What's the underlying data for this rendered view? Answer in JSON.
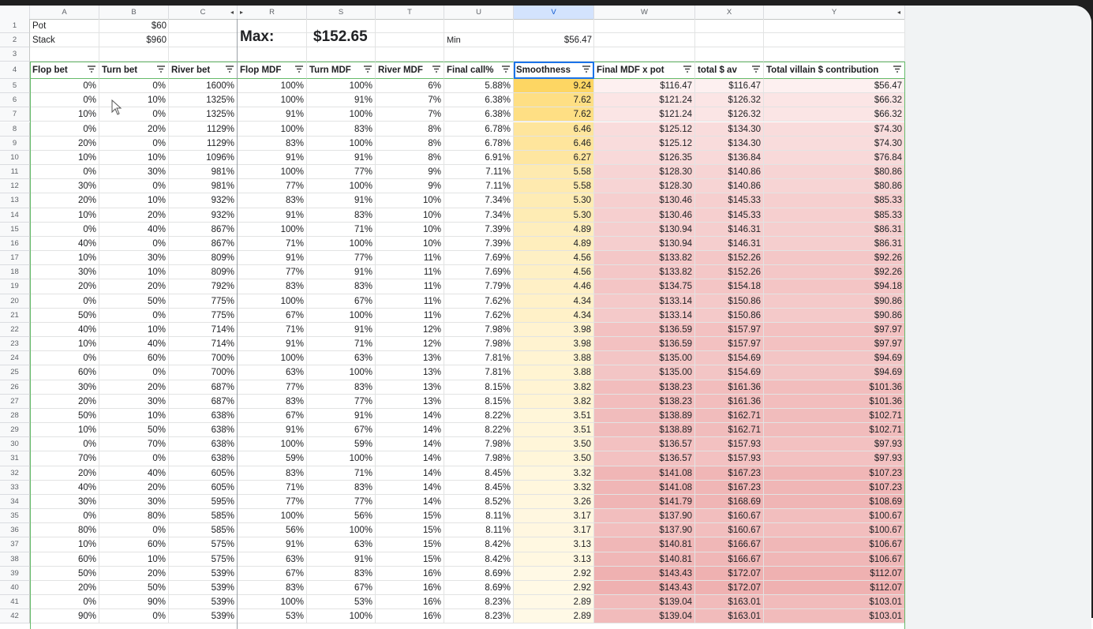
{
  "columns": [
    {
      "letter": "A",
      "header": "Flop bet"
    },
    {
      "letter": "B",
      "header": "Turn bet"
    },
    {
      "letter": "C",
      "header": "River bet"
    },
    {
      "letter": "R",
      "header": "Flop MDF"
    },
    {
      "letter": "S",
      "header": "Turn MDF"
    },
    {
      "letter": "T",
      "header": "River MDF"
    },
    {
      "letter": "U",
      "header": "Final call%"
    },
    {
      "letter": "V",
      "header": "Smoothness"
    },
    {
      "letter": "W",
      "header": "Final MDF x pot"
    },
    {
      "letter": "X",
      "header": "total $ av"
    },
    {
      "letter": "Y",
      "header": "Total villain $ contribution"
    }
  ],
  "top": {
    "pot_label": "Pot",
    "pot_value": "$60",
    "stack_label": "Stack",
    "stack_value": "$960",
    "max_label": "Max:",
    "max_value": "$152.65",
    "min_label": "Min",
    "min_value": "$56.47"
  },
  "header_row_number": "4",
  "top_row_numbers": [
    "1",
    "2",
    "3"
  ],
  "colors": {
    "smooth_max": "#fdd663",
    "smooth_min": "#fff9e6",
    "pink_max": "#efb1b1",
    "pink_min": "#fdf0f0",
    "selection": "#1a73e8",
    "filter_green": "#66bb6a"
  },
  "rows": [
    {
      "n": "5",
      "v": [
        "0%",
        "0%",
        "1600%",
        "100%",
        "100%",
        "6%",
        "5.88%",
        "9.24",
        "$116.47",
        "$116.47",
        "$56.47"
      ]
    },
    {
      "n": "6",
      "v": [
        "0%",
        "10%",
        "1325%",
        "100%",
        "91%",
        "7%",
        "6.38%",
        "7.62",
        "$121.24",
        "$126.32",
        "$66.32"
      ]
    },
    {
      "n": "7",
      "v": [
        "10%",
        "0%",
        "1325%",
        "91%",
        "100%",
        "7%",
        "6.38%",
        "7.62",
        "$121.24",
        "$126.32",
        "$66.32"
      ]
    },
    {
      "n": "8",
      "v": [
        "0%",
        "20%",
        "1129%",
        "100%",
        "83%",
        "8%",
        "6.78%",
        "6.46",
        "$125.12",
        "$134.30",
        "$74.30"
      ]
    },
    {
      "n": "9",
      "v": [
        "20%",
        "0%",
        "1129%",
        "83%",
        "100%",
        "8%",
        "6.78%",
        "6.46",
        "$125.12",
        "$134.30",
        "$74.30"
      ]
    },
    {
      "n": "10",
      "v": [
        "10%",
        "10%",
        "1096%",
        "91%",
        "91%",
        "8%",
        "6.91%",
        "6.27",
        "$126.35",
        "$136.84",
        "$76.84"
      ]
    },
    {
      "n": "11",
      "v": [
        "0%",
        "30%",
        "981%",
        "100%",
        "77%",
        "9%",
        "7.11%",
        "5.58",
        "$128.30",
        "$140.86",
        "$80.86"
      ]
    },
    {
      "n": "12",
      "v": [
        "30%",
        "0%",
        "981%",
        "77%",
        "100%",
        "9%",
        "7.11%",
        "5.58",
        "$128.30",
        "$140.86",
        "$80.86"
      ]
    },
    {
      "n": "13",
      "v": [
        "20%",
        "10%",
        "932%",
        "83%",
        "91%",
        "10%",
        "7.34%",
        "5.30",
        "$130.46",
        "$145.33",
        "$85.33"
      ]
    },
    {
      "n": "14",
      "v": [
        "10%",
        "20%",
        "932%",
        "91%",
        "83%",
        "10%",
        "7.34%",
        "5.30",
        "$130.46",
        "$145.33",
        "$85.33"
      ]
    },
    {
      "n": "15",
      "v": [
        "0%",
        "40%",
        "867%",
        "100%",
        "71%",
        "10%",
        "7.39%",
        "4.89",
        "$130.94",
        "$146.31",
        "$86.31"
      ]
    },
    {
      "n": "16",
      "v": [
        "40%",
        "0%",
        "867%",
        "71%",
        "100%",
        "10%",
        "7.39%",
        "4.89",
        "$130.94",
        "$146.31",
        "$86.31"
      ]
    },
    {
      "n": "17",
      "v": [
        "10%",
        "30%",
        "809%",
        "91%",
        "77%",
        "11%",
        "7.69%",
        "4.56",
        "$133.82",
        "$152.26",
        "$92.26"
      ]
    },
    {
      "n": "18",
      "v": [
        "30%",
        "10%",
        "809%",
        "77%",
        "91%",
        "11%",
        "7.69%",
        "4.56",
        "$133.82",
        "$152.26",
        "$92.26"
      ]
    },
    {
      "n": "19",
      "v": [
        "20%",
        "20%",
        "792%",
        "83%",
        "83%",
        "11%",
        "7.79%",
        "4.46",
        "$134.75",
        "$154.18",
        "$94.18"
      ]
    },
    {
      "n": "20",
      "v": [
        "0%",
        "50%",
        "775%",
        "100%",
        "67%",
        "11%",
        "7.62%",
        "4.34",
        "$133.14",
        "$150.86",
        "$90.86"
      ]
    },
    {
      "n": "21",
      "v": [
        "50%",
        "0%",
        "775%",
        "67%",
        "100%",
        "11%",
        "7.62%",
        "4.34",
        "$133.14",
        "$150.86",
        "$90.86"
      ]
    },
    {
      "n": "22",
      "v": [
        "40%",
        "10%",
        "714%",
        "71%",
        "91%",
        "12%",
        "7.98%",
        "3.98",
        "$136.59",
        "$157.97",
        "$97.97"
      ]
    },
    {
      "n": "23",
      "v": [
        "10%",
        "40%",
        "714%",
        "91%",
        "71%",
        "12%",
        "7.98%",
        "3.98",
        "$136.59",
        "$157.97",
        "$97.97"
      ]
    },
    {
      "n": "24",
      "v": [
        "0%",
        "60%",
        "700%",
        "100%",
        "63%",
        "13%",
        "7.81%",
        "3.88",
        "$135.00",
        "$154.69",
        "$94.69"
      ]
    },
    {
      "n": "25",
      "v": [
        "60%",
        "0%",
        "700%",
        "63%",
        "100%",
        "13%",
        "7.81%",
        "3.88",
        "$135.00",
        "$154.69",
        "$94.69"
      ]
    },
    {
      "n": "26",
      "v": [
        "30%",
        "20%",
        "687%",
        "77%",
        "83%",
        "13%",
        "8.15%",
        "3.82",
        "$138.23",
        "$161.36",
        "$101.36"
      ]
    },
    {
      "n": "27",
      "v": [
        "20%",
        "30%",
        "687%",
        "83%",
        "77%",
        "13%",
        "8.15%",
        "3.82",
        "$138.23",
        "$161.36",
        "$101.36"
      ]
    },
    {
      "n": "28",
      "v": [
        "50%",
        "10%",
        "638%",
        "67%",
        "91%",
        "14%",
        "8.22%",
        "3.51",
        "$138.89",
        "$162.71",
        "$102.71"
      ]
    },
    {
      "n": "29",
      "v": [
        "10%",
        "50%",
        "638%",
        "91%",
        "67%",
        "14%",
        "8.22%",
        "3.51",
        "$138.89",
        "$162.71",
        "$102.71"
      ]
    },
    {
      "n": "30",
      "v": [
        "0%",
        "70%",
        "638%",
        "100%",
        "59%",
        "14%",
        "7.98%",
        "3.50",
        "$136.57",
        "$157.93",
        "$97.93"
      ]
    },
    {
      "n": "31",
      "v": [
        "70%",
        "0%",
        "638%",
        "59%",
        "100%",
        "14%",
        "7.98%",
        "3.50",
        "$136.57",
        "$157.93",
        "$97.93"
      ]
    },
    {
      "n": "32",
      "v": [
        "20%",
        "40%",
        "605%",
        "83%",
        "71%",
        "14%",
        "8.45%",
        "3.32",
        "$141.08",
        "$167.23",
        "$107.23"
      ]
    },
    {
      "n": "33",
      "v": [
        "40%",
        "20%",
        "605%",
        "71%",
        "83%",
        "14%",
        "8.45%",
        "3.32",
        "$141.08",
        "$167.23",
        "$107.23"
      ]
    },
    {
      "n": "34",
      "v": [
        "30%",
        "30%",
        "595%",
        "77%",
        "77%",
        "14%",
        "8.52%",
        "3.26",
        "$141.79",
        "$168.69",
        "$108.69"
      ]
    },
    {
      "n": "35",
      "v": [
        "0%",
        "80%",
        "585%",
        "100%",
        "56%",
        "15%",
        "8.11%",
        "3.17",
        "$137.90",
        "$160.67",
        "$100.67"
      ]
    },
    {
      "n": "36",
      "v": [
        "80%",
        "0%",
        "585%",
        "56%",
        "100%",
        "15%",
        "8.11%",
        "3.17",
        "$137.90",
        "$160.67",
        "$100.67"
      ]
    },
    {
      "n": "37",
      "v": [
        "10%",
        "60%",
        "575%",
        "91%",
        "63%",
        "15%",
        "8.42%",
        "3.13",
        "$140.81",
        "$166.67",
        "$106.67"
      ]
    },
    {
      "n": "38",
      "v": [
        "60%",
        "10%",
        "575%",
        "63%",
        "91%",
        "15%",
        "8.42%",
        "3.13",
        "$140.81",
        "$166.67",
        "$106.67"
      ]
    },
    {
      "n": "39",
      "v": [
        "50%",
        "20%",
        "539%",
        "67%",
        "83%",
        "16%",
        "8.69%",
        "2.92",
        "$143.43",
        "$172.07",
        "$112.07"
      ]
    },
    {
      "n": "40",
      "v": [
        "20%",
        "50%",
        "539%",
        "83%",
        "67%",
        "16%",
        "8.69%",
        "2.92",
        "$143.43",
        "$172.07",
        "$112.07"
      ]
    },
    {
      "n": "41",
      "v": [
        "0%",
        "90%",
        "539%",
        "100%",
        "53%",
        "16%",
        "8.23%",
        "2.89",
        "$139.04",
        "$163.01",
        "$103.01"
      ]
    },
    {
      "n": "42",
      "v": [
        "90%",
        "0%",
        "539%",
        "53%",
        "100%",
        "16%",
        "8.23%",
        "2.89",
        "$139.04",
        "$163.01",
        "$103.01"
      ]
    }
  ]
}
